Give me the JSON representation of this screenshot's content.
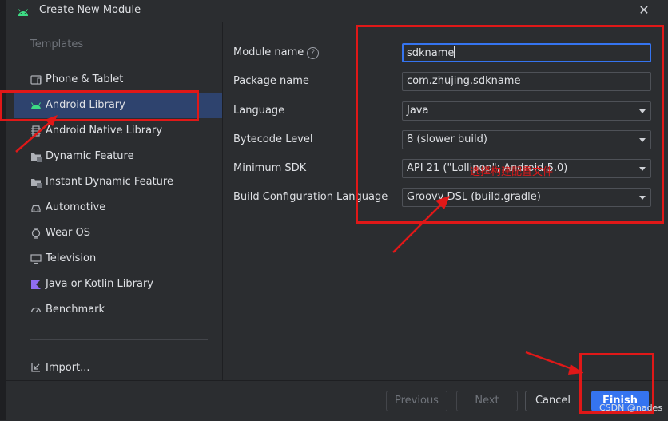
{
  "window": {
    "title": "Create New Module",
    "close_label": "✕"
  },
  "sidebar": {
    "heading": "Templates",
    "items": [
      {
        "label": "Phone & Tablet",
        "icon": "phone-tablet-icon"
      },
      {
        "label": "Android Library",
        "icon": "android-icon",
        "selected": true
      },
      {
        "label": "Android Native Library",
        "icon": "native-library-icon"
      },
      {
        "label": "Dynamic Feature",
        "icon": "folder-feature-icon"
      },
      {
        "label": "Instant Dynamic Feature",
        "icon": "folder-instant-icon"
      },
      {
        "label": "Automotive",
        "icon": "car-icon"
      },
      {
        "label": "Wear OS",
        "icon": "watch-icon"
      },
      {
        "label": "Television",
        "icon": "tv-icon"
      },
      {
        "label": "Java or Kotlin Library",
        "icon": "kotlin-icon"
      },
      {
        "label": "Benchmark",
        "icon": "gauge-icon"
      }
    ],
    "import_label": "Import..."
  },
  "form": {
    "module_name": {
      "label": "Module name",
      "value": "sdkname"
    },
    "package_name": {
      "label": "Package name",
      "value": "com.zhujing.sdkname"
    },
    "language": {
      "label": "Language",
      "value": "Java"
    },
    "bytecode": {
      "label": "Bytecode Level",
      "value": "8 (slower build)"
    },
    "min_sdk": {
      "label": "Minimum SDK",
      "value": "API 21 (\"Lollipop\"; Android 5.0)"
    },
    "build_config": {
      "label": "Build Configuration Language",
      "value": "Groovy DSL (build.gradle)"
    }
  },
  "annotation": {
    "text": "选择构建配置文件"
  },
  "footer": {
    "previous_label": "Previous",
    "next_label": "Next",
    "cancel_label": "Cancel",
    "finish_label": "Finish"
  },
  "watermark": "CSDN @nades",
  "colors": {
    "accent": "#3574f0",
    "selected_bg": "#2e436e",
    "annotation_red": "#e01818",
    "android_green": "#3ddc84"
  }
}
